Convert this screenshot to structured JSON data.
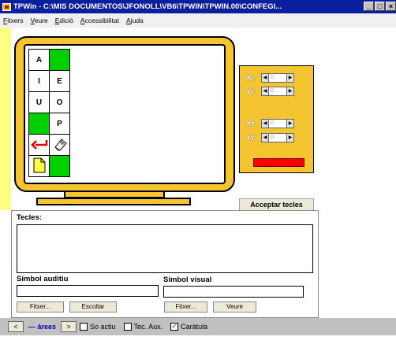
{
  "window": {
    "title": "TPWin - C:\\MIS DOCUMENTOS\\JFONOLL\\VB6\\TPWIN\\TPWIN.00\\CONFEGI...",
    "min": "_",
    "max": "□",
    "close": "×"
  },
  "menu": [
    {
      "pre": "",
      "u": "F",
      "post": "itxers"
    },
    {
      "pre": "",
      "u": "V",
      "post": "eure"
    },
    {
      "pre": "",
      "u": "E",
      "post": "dició"
    },
    {
      "pre": "",
      "u": "A",
      "post": "ccessibilitat"
    },
    {
      "pre": "",
      "u": "A",
      "post": "juda"
    }
  ],
  "grid": [
    {
      "text": "A",
      "green": false,
      "icon": ""
    },
    {
      "text": "",
      "green": true,
      "icon": ""
    },
    {
      "text": "I",
      "green": false,
      "icon": ""
    },
    {
      "text": "E",
      "green": false,
      "icon": ""
    },
    {
      "text": "U",
      "green": false,
      "icon": ""
    },
    {
      "text": "O",
      "green": false,
      "icon": ""
    },
    {
      "text": "",
      "green": true,
      "icon": ""
    },
    {
      "text": "P",
      "green": false,
      "icon": ""
    },
    {
      "text": "",
      "green": false,
      "icon": "back-arrow-icon"
    },
    {
      "text": "",
      "green": false,
      "icon": "eraser-icon"
    },
    {
      "text": "",
      "green": false,
      "icon": "document-icon"
    },
    {
      "text": "",
      "green": true,
      "icon": ""
    }
  ],
  "coords": {
    "xi": {
      "label": "Xi:",
      "value": "0"
    },
    "yi": {
      "label": "Yi:",
      "value": "0"
    },
    "xf": {
      "label": "Xf:",
      "value": "0"
    },
    "yf": {
      "label": "Yf:",
      "value": "0"
    },
    "color": "#ff0000"
  },
  "tab": {
    "label": "Acceptar tecles"
  },
  "panel": {
    "tecles_label": "Tecles:",
    "auditiu_label": "Símbol auditiu",
    "visual_label": "Símbol visual",
    "auditiu_buttons": [
      "Fitxer...",
      "Escoltar"
    ],
    "visual_buttons": [
      "Fitxer...",
      "Veure"
    ]
  },
  "bottom": {
    "prev": "<",
    "next": ">",
    "areas": "— àrees",
    "so_actiu": "So actiu",
    "tec_aux": "Tec. Aux.",
    "caratula": "Caràtula",
    "caratula_checked": "✓"
  }
}
